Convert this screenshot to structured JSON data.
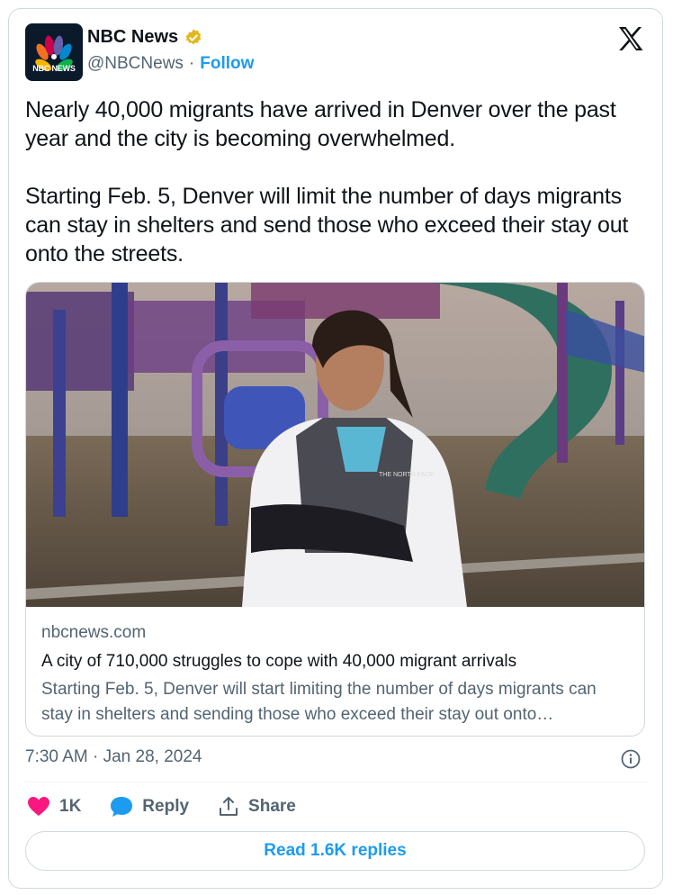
{
  "author": {
    "name": "NBC News",
    "handle": "@NBCNews",
    "separator": "·",
    "follow_label": "Follow",
    "avatar_text": "NBC NEWS"
  },
  "tweet": {
    "paragraphs": [
      "Nearly 40,000 migrants have arrived in Denver over the past year and the city is becoming overwhelmed.",
      "Starting Feb. 5, Denver will limit the number of days migrants can stay in shelters and send those who exceed their stay out onto the streets."
    ],
    "timestamp": "7:30 AM · Jan 28, 2024"
  },
  "link_card": {
    "domain": "nbcnews.com",
    "title": "A city of 710,000 struggles to cope with 40,000 migrant arrivals",
    "description": "Starting Feb. 5, Denver will start limiting the number of days migrants can stay in shelters and sending those who exceed their stay out onto…",
    "jacket_logo_text": "THE NORTH FACE"
  },
  "actions": {
    "like_count": "1K",
    "reply_label": "Reply",
    "share_label": "Share"
  },
  "read_replies_label": "Read 1.6K replies",
  "icons": [
    "verified-badge-icon",
    "x-logo-icon",
    "info-icon",
    "heart-icon",
    "reply-bubble-icon",
    "share-icon"
  ],
  "colors": {
    "accent": "#1d9bf0",
    "heart": "#f91880",
    "text": "#0f1419",
    "secondary": "#536471",
    "border": "#cfd9de",
    "verified": "#e2b719"
  }
}
